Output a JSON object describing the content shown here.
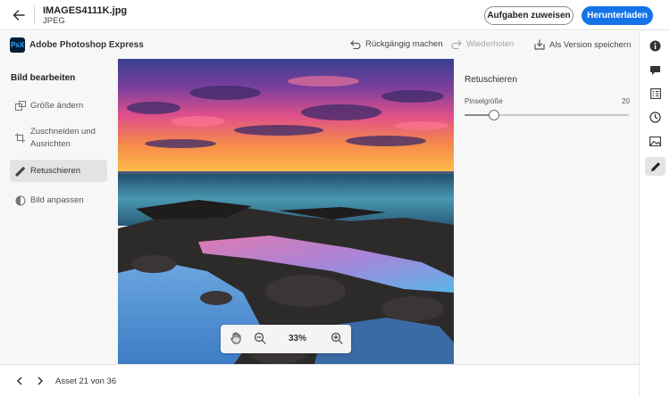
{
  "header": {
    "file_name": "IMAGES4111K.jpg",
    "file_type": "JPEG",
    "assign_tasks_label": "Aufgaben zuweisen",
    "download_label": "Herunterladen"
  },
  "appbar": {
    "logo_text": "PsX",
    "app_name": "Adobe Photoshop Express",
    "undo_label": "Rückgängig machen",
    "redo_label": "Wiederholen",
    "save_version_label": "Als Version speichern"
  },
  "sidebar": {
    "title": "Bild bearbeiten",
    "items": [
      {
        "label": "Größe ändern",
        "icon": "resize-icon",
        "active": false
      },
      {
        "label": "Zuschneiden und Ausrichten",
        "icon": "crop-icon",
        "active": false
      },
      {
        "label": "Retuschieren",
        "icon": "healing-brush-icon",
        "active": true
      },
      {
        "label": "Bild anpassen",
        "icon": "adjust-icon",
        "active": false
      }
    ]
  },
  "zoom": {
    "value": "33%"
  },
  "panel": {
    "title": "Retuschieren",
    "brush_label": "Pinselgröße",
    "brush_value": "20",
    "slider_fraction": 0.18
  },
  "footer": {
    "asset_position": "Asset 21 von 36"
  },
  "right_rail": [
    "info-icon",
    "comment-icon",
    "tasks-icon",
    "history-icon",
    "image-icon",
    "edit-pencil-icon"
  ],
  "colors": {
    "accent": "#1473e6",
    "logo_bg": "#001e36",
    "logo_text": "#31a8ff"
  }
}
